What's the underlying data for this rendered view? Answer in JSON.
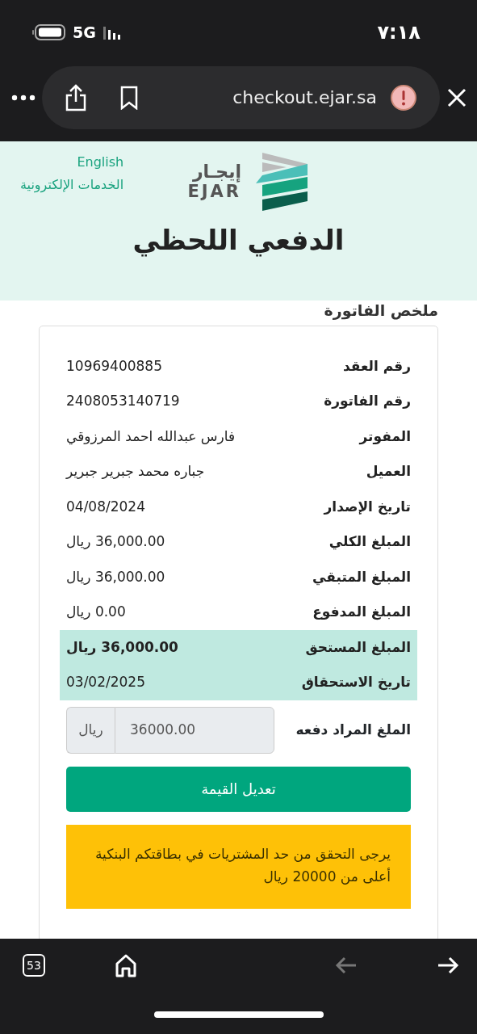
{
  "status_bar": {
    "time": "٧:١٨",
    "network": "5G"
  },
  "browser": {
    "url": "checkout.ejar.sa",
    "tab_count": "53",
    "back_disabled": true
  },
  "header": {
    "language_link": "English",
    "services_link": "الخدمات الإلكترونية",
    "logo_arabic": "إيجـار",
    "logo_latin": "EJAR",
    "title": "الدفعي اللحظي"
  },
  "invoice": {
    "heading": "ملخص الفاتورة",
    "rows": [
      {
        "label": "رقم العقد",
        "value": "10969400885",
        "highlighted": false,
        "bold": false
      },
      {
        "label": "رقم الفاتورة",
        "value": "2408053140719",
        "highlighted": false,
        "bold": false
      },
      {
        "label": "المفوتر",
        "value": "فارس عبدالله احمد المرزوقي",
        "highlighted": false,
        "bold": false
      },
      {
        "label": "العميل",
        "value": "جباره محمد جبرير جبرير",
        "highlighted": false,
        "bold": false
      },
      {
        "label": "تاريخ الإصدار",
        "value": "04/08/2024",
        "highlighted": false,
        "bold": false
      },
      {
        "label": "المبلغ الكلي",
        "value": "36,000.00 ريال",
        "highlighted": false,
        "bold": false
      },
      {
        "label": "المبلغ المتبقي",
        "value": "36,000.00 ريال",
        "highlighted": false,
        "bold": false
      },
      {
        "label": "المبلغ المدفوع",
        "value": "0.00 ريال",
        "highlighted": false,
        "bold": false
      },
      {
        "label": "المبلغ المستحق",
        "value": "36,000.00 ريال",
        "highlighted": true,
        "bold": true
      },
      {
        "label": "تاريخ الاستحقاق",
        "value": "03/02/2025",
        "highlighted": true,
        "bold": false
      }
    ],
    "amount_field": {
      "label": "الملغ المراد دفعه",
      "value": "36000.00",
      "currency": "ريال",
      "disabled": true
    },
    "submit_button": "تعديل القيمة",
    "notice": "يرجى التحقق من حد المشتريات في بطاقتكم البنكية أعلى من 20000 ريال"
  }
}
